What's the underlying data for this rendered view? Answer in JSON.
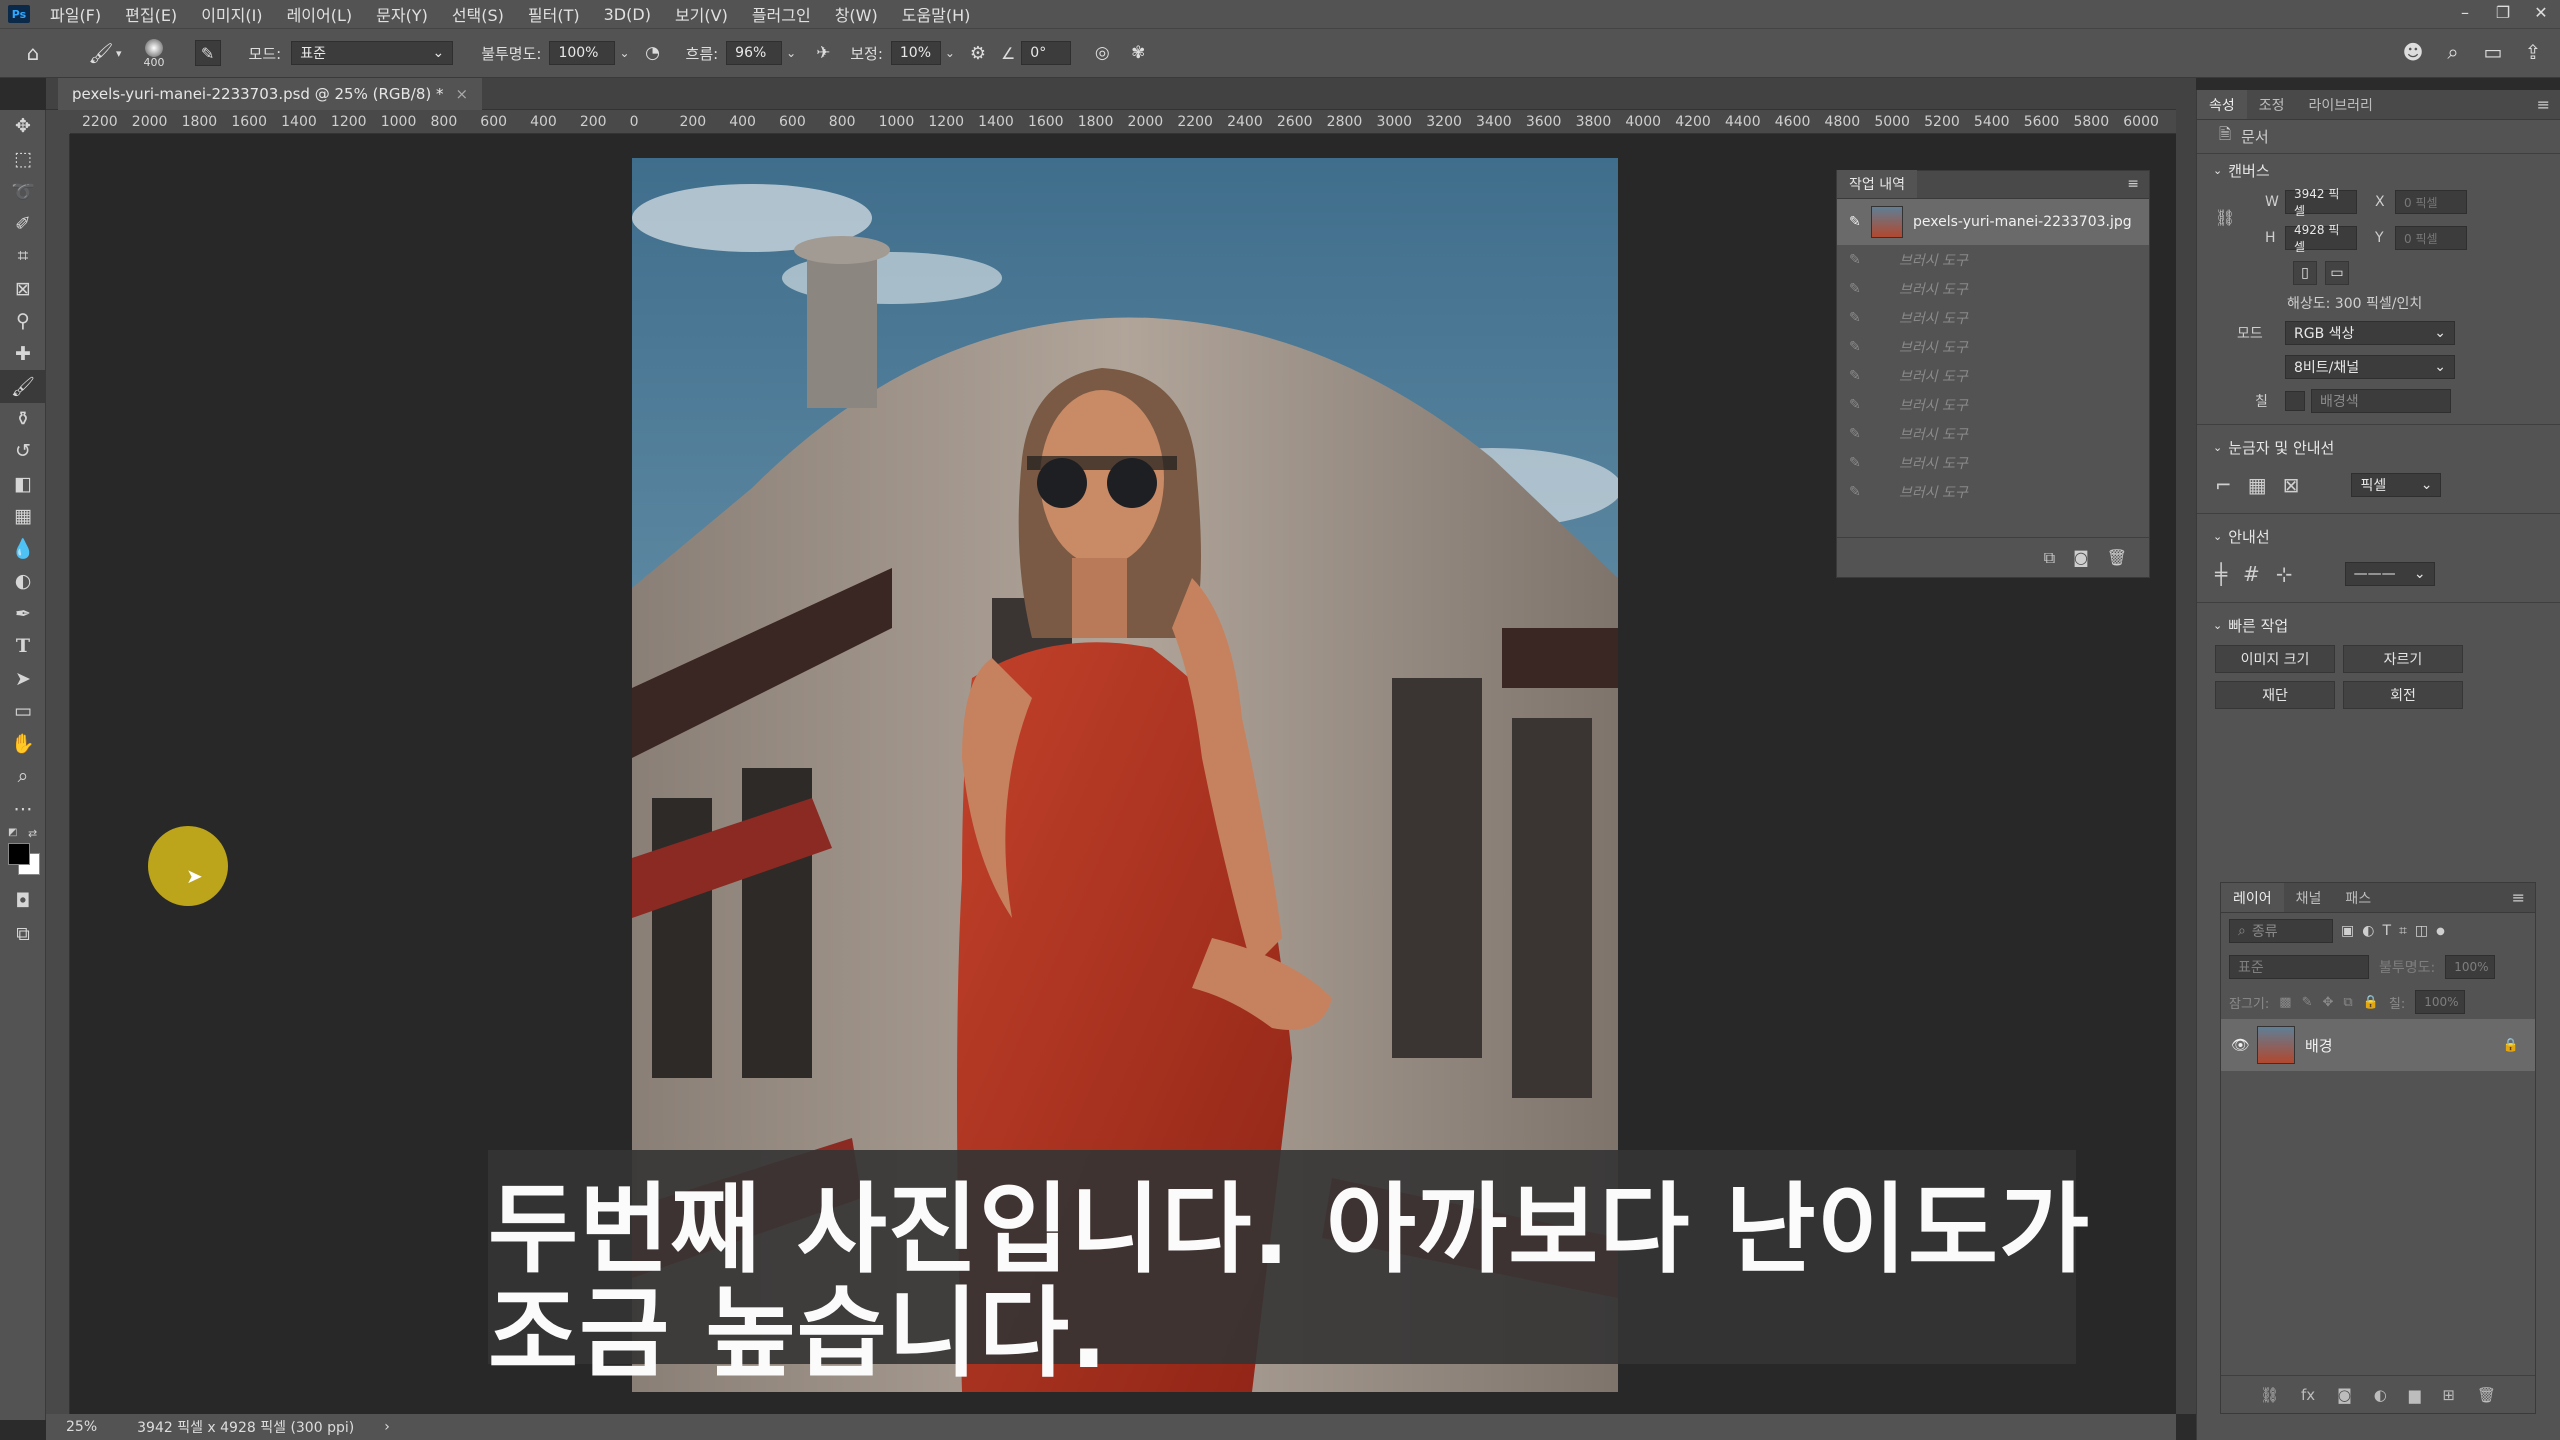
{
  "app": {
    "logo": "Ps"
  },
  "menu": [
    "파일(F)",
    "편집(E)",
    "이미지(I)",
    "레이어(L)",
    "문자(Y)",
    "선택(S)",
    "필터(T)",
    "3D(D)",
    "보기(V)",
    "플러그인",
    "창(W)",
    "도움말(H)"
  ],
  "window_controls": [
    "–",
    "❐",
    "✕"
  ],
  "options": {
    "brush_size": "400",
    "mode_label": "모드:",
    "mode_value": "표준",
    "opacity_label": "불투명도:",
    "opacity_value": "100%",
    "flow_label": "흐름:",
    "flow_value": "96%",
    "smoothing_label": "보정:",
    "smoothing_value": "10%",
    "angle_value": "0°"
  },
  "document": {
    "tab_title": "pexels-yuri-manei-2233703.psd @ 25% (RGB/8) *",
    "tab_close": "×"
  },
  "ruler_h": [
    "2200",
    "2000",
    "1800",
    "1600",
    "1400",
    "1200",
    "1000",
    "800",
    "600",
    "400",
    "200",
    "0",
    "200",
    "400",
    "600",
    "800",
    "1000",
    "1200",
    "1400",
    "1600",
    "1800",
    "2000",
    "2200",
    "2400",
    "2600",
    "2800",
    "3000",
    "3200",
    "3400",
    "3600",
    "3800",
    "4000",
    "4200",
    "4400",
    "4600",
    "4800",
    "5000",
    "5200",
    "5400",
    "5600",
    "5800",
    "6000"
  ],
  "caption": {
    "line1": "두번째 사진입니다. 아까보다 난이도가",
    "line2": "조금 높습니다."
  },
  "status": {
    "zoom": "25%",
    "info": "3942 픽셀 x 4928 픽셀 (300 ppi)",
    "arrow": "›"
  },
  "history": {
    "tab": "작업 내역",
    "snapshot": "pexels-yuri-manei-2233703.jpg",
    "items": [
      "브러시 도구",
      "브러시 도구",
      "브러시 도구",
      "브러시 도구",
      "브러시 도구",
      "브러시 도구",
      "브러시 도구",
      "브러시 도구",
      "브러시 도구"
    ]
  },
  "properties": {
    "tabs": [
      "속성",
      "조정",
      "라이브러리"
    ],
    "doc_label": "문서",
    "canvas_section": "캔버스",
    "w_label": "W",
    "w_value": "3942 픽셀",
    "h_label": "H",
    "h_value": "4928 픽셀",
    "x_label": "X",
    "x_placeholder": "0 픽셀",
    "y_label": "Y",
    "y_placeholder": "0 픽셀",
    "resolution": "해상도: 300 픽셀/인치",
    "mode_label": "모드",
    "mode_value": "RGB 색상",
    "depth_value": "8비트/채널",
    "fill_label": "칠",
    "fill_value": "배경색",
    "rulers_section": "눈금자 및 안내선",
    "unit_value": "픽셀",
    "guides_section": "안내선",
    "quick_section": "빠른 작업",
    "btn_image_size": "이미지 크기",
    "btn_crop": "자르기",
    "btn_trim": "재단",
    "btn_rotate": "회전"
  },
  "layers": {
    "tabs": [
      "레이어",
      "채널",
      "패스"
    ],
    "filter_placeholder": "종류",
    "blend": "표준",
    "opacity_label": "불투명도:",
    "opacity_value": "100%",
    "lock_label": "잠그기:",
    "fill_label": "칠:",
    "fill_value": "100%",
    "layer_name": "배경"
  }
}
